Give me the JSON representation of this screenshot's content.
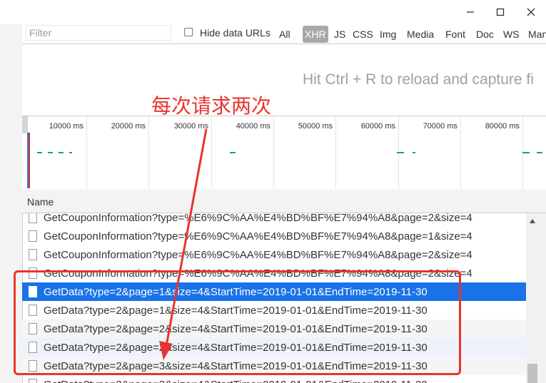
{
  "window": {
    "minimize_icon": "minimize-icon",
    "maximize_icon": "maximize-icon",
    "close_icon": "close-icon"
  },
  "toolbar": {
    "filter_placeholder": "Filter",
    "hide_data_urls_label": "Hide data URLs",
    "hide_data_urls_checked": false,
    "types": [
      "All",
      "XHR",
      "JS",
      "CSS",
      "Img",
      "Media",
      "Font",
      "Doc",
      "WS",
      "Man"
    ],
    "selected_type": "XHR"
  },
  "empty_hint": "Hit Ctrl + R to reload and capture fi",
  "overview": {
    "tick_labels": [
      "10000 ms",
      "20000 ms",
      "30000 ms",
      "40000 ms",
      "50000 ms",
      "60000 ms",
      "70000 ms",
      "80000 ms"
    ]
  },
  "annotation": {
    "text": "每次请求两次",
    "color": "#e8342e"
  },
  "grid": {
    "name_header": "Name",
    "rows": [
      {
        "name": "GetCouponInformation?type=%E6%9C%AA%E4%BD%BF%E7%94%A8&page=2&size=4",
        "style": "normal"
      },
      {
        "name": "GetCouponInformation?type=%E6%9C%AA%E4%BD%BF%E7%94%A8&page=1&size=4",
        "style": "normal"
      },
      {
        "name": "GetCouponInformation?type=%E6%9C%AA%E4%BD%BF%E7%94%A8&page=2&size=4",
        "style": "normal"
      },
      {
        "name": "GetCouponInformation?type=%E6%9C%AA%E4%BD%BF%E7%94%A8&page=2&size=4",
        "style": "normal"
      },
      {
        "name": "GetData?type=2&page=1&size=4&StartTime=2019-01-01&EndTime=2019-11-30",
        "style": "selected"
      },
      {
        "name": "GetData?type=2&page=1&size=4&StartTime=2019-01-01&EndTime=2019-11-30",
        "style": "normal"
      },
      {
        "name": "GetData?type=2&page=2&size=4&StartTime=2019-01-01&EndTime=2019-11-30",
        "style": "alt"
      },
      {
        "name": "GetData?type=2&page=2&size=4&StartTime=2019-01-01&EndTime=2019-11-30",
        "style": "tint"
      },
      {
        "name": "GetData?type=2&page=3&size=4&StartTime=2019-01-01&EndTime=2019-11-30",
        "style": "alt"
      },
      {
        "name": "GetData?type=2&page=3&size=4&StartTime=2019-01-01&EndTime=2019-11-30",
        "style": "normal"
      }
    ]
  },
  "colors": {
    "selected_row": "#1a73e8",
    "highlight": "#e8342e",
    "timeline_bar": "#16a085"
  }
}
